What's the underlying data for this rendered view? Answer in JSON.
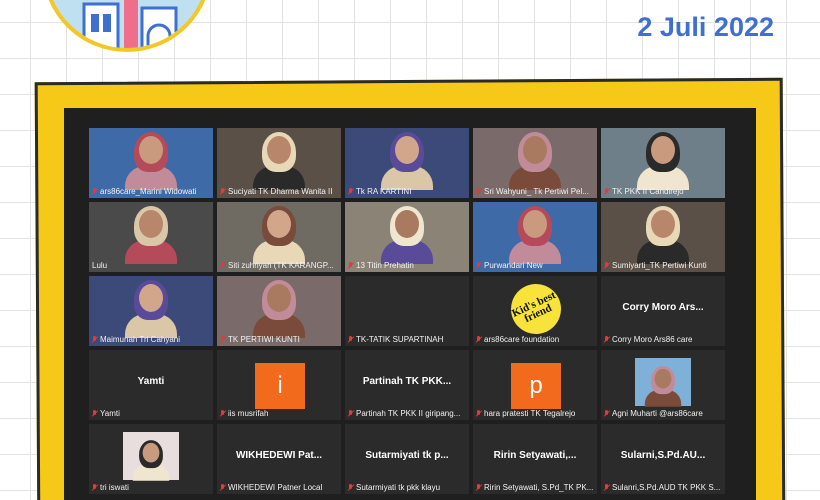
{
  "header": {
    "date": "2 Juli 2022"
  },
  "colors": {
    "frame": "#f6c818",
    "accent_date": "#3f6fd0",
    "avatar_orange": "#f26b1d",
    "mic_muted": "#e43a3a"
  },
  "participants": [
    {
      "name": "ars86care_Marini Widowati",
      "kind": "video",
      "muted": true
    },
    {
      "name": "Suciyati TK Dharma Wanita II",
      "kind": "video",
      "muted": true
    },
    {
      "name": "Tk RA KARTINI",
      "kind": "video",
      "muted": true
    },
    {
      "name": "Sri Wahyuni_ Tk Pertiwi Pel...",
      "kind": "video",
      "muted": true
    },
    {
      "name": "TK PKK II Candirejo",
      "kind": "video",
      "muted": true
    },
    {
      "name": "Lulu",
      "kind": "video",
      "muted": false
    },
    {
      "name": "Siti zuhriyah (TK KARANGP...",
      "kind": "video",
      "muted": true
    },
    {
      "name": "13 Titin Prehatin",
      "kind": "video",
      "muted": true
    },
    {
      "name": "Purwandari New",
      "kind": "video",
      "muted": true
    },
    {
      "name": "Sumiyarti_TK Pertiwi Kunti",
      "kind": "video",
      "muted": true
    },
    {
      "name": "Maimunah Tri Cahyani",
      "kind": "video",
      "muted": true
    },
    {
      "name": "TK PERTIWI KUNTI",
      "kind": "video",
      "muted": true
    },
    {
      "name": "TK-TATIK SUPARTINAH",
      "kind": "blank",
      "muted": true
    },
    {
      "name": "ars86care foundation",
      "kind": "logo",
      "logo_text": "Kid's best friend",
      "muted": true
    },
    {
      "name": "Corry Moro Ars86 care",
      "kind": "text",
      "display": "Corry Moro Ars...",
      "muted": true
    },
    {
      "name": "Yamti",
      "kind": "text",
      "display": "Yamti",
      "muted": true
    },
    {
      "name": "iis musrifah",
      "kind": "letter",
      "letter": "i",
      "muted": true
    },
    {
      "name": "Partinah TK PKK II giripang...",
      "kind": "text",
      "display": "Partinah TK PKK...",
      "muted": true
    },
    {
      "name": "hara pratesti TK Tegalrejo",
      "kind": "letter",
      "letter": "p",
      "muted": true
    },
    {
      "name": "Agni Muharti @ars86care",
      "kind": "photo",
      "muted": true
    },
    {
      "name": "tri iswati",
      "kind": "photo",
      "muted": true
    },
    {
      "name": "WIKHEDEWI Patner Local",
      "kind": "text",
      "display": "WIKHEDEWI Pat...",
      "muted": true
    },
    {
      "name": "Sutarmiyati tk pkk klayu",
      "kind": "text",
      "display": "Sutarmiyati tk p...",
      "muted": true
    },
    {
      "name": "Ririn Setyawati, S.Pd_TK PK...",
      "kind": "text",
      "display": "Ririn Setyawati,...",
      "muted": true
    },
    {
      "name": "Sulanri,S.Pd.AUD TK PKK S...",
      "kind": "text",
      "display": "Sularni,S.Pd.AU...",
      "muted": true
    }
  ]
}
